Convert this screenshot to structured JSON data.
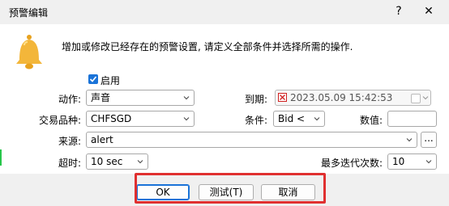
{
  "window": {
    "title": "预警编辑",
    "help": "?",
    "close": "✕"
  },
  "description": "增加或修改已经存在的预警设置, 请定义全部条件并选择所需的操作.",
  "enable": {
    "label": "启用",
    "checked": true
  },
  "action": {
    "label": "动作:",
    "value": "声音"
  },
  "expiry": {
    "label": "到期:",
    "value": "2023.05.09 15:42:53"
  },
  "symbol": {
    "label": "交易品种:",
    "value": "CHFSGD"
  },
  "condition": {
    "label": "条件:",
    "value": "Bid <"
  },
  "numeric": {
    "label": "数值:",
    "value": ""
  },
  "source": {
    "label": "来源:",
    "value": "alert",
    "browse": "..."
  },
  "timeout": {
    "label": "超时:",
    "value": "10 sec"
  },
  "max_iter": {
    "label": "最多迭代次数:",
    "value": "10"
  },
  "buttons": {
    "ok": "OK",
    "test": "测试(T)",
    "cancel": "取消"
  },
  "colors": {
    "accent": "#1a73d8",
    "highlight": "#e03030",
    "bell": "#f3b63a"
  },
  "icons": {
    "bell": "bell-icon"
  }
}
